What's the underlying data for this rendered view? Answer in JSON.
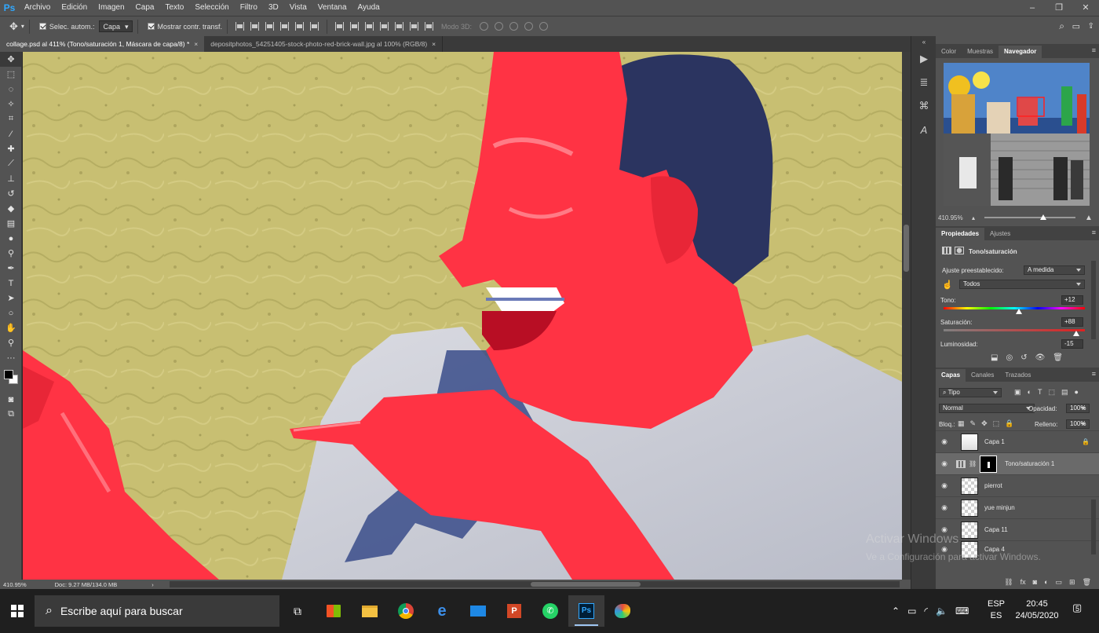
{
  "app": {
    "logo": "Ps"
  },
  "menu": [
    "Archivo",
    "Edición",
    "Imagen",
    "Capa",
    "Texto",
    "Selección",
    "Filtro",
    "3D",
    "Vista",
    "Ventana",
    "Ayuda"
  ],
  "options": {
    "auto_select_label": "Selec. autom.:",
    "auto_select_value": "Capa",
    "show_transform_label": "Mostrar contr. transf.",
    "mode3d_label": "Modo 3D:"
  },
  "tabs": [
    {
      "label": "collage.psd al 411% (Tono/saturación 1, Máscara de capa/8) *",
      "close": "×"
    },
    {
      "label": "depositphotos_54251405-stock-photo-red-brick-wall.jpg al 100% (RGB/8)",
      "close": "×"
    }
  ],
  "status": {
    "zoom": "410.95%",
    "doc": "Doc: 9.27 MB/134.0 MB"
  },
  "navigator": {
    "tabs": [
      "Color",
      "Muestras",
      "Navegador"
    ],
    "zoom": "410.95%"
  },
  "properties": {
    "tabs": [
      "Propiedades",
      "Ajustes"
    ],
    "title": "Tono/saturación",
    "preset_label": "Ajuste preestablecido:",
    "preset_value": "A medida",
    "channel_value": "Todos",
    "hue_label": "Tono:",
    "hue_value": "+12",
    "hue": 12,
    "sat_label": "Saturación:",
    "sat_value": "+88",
    "sat": 88,
    "light_label": "Luminosidad:",
    "light_value": "-15",
    "light": -15
  },
  "layers_panel": {
    "tabs": [
      "Capas",
      "Canales",
      "Trazados"
    ],
    "filter_value": "Tipo",
    "blend_value": "Normal",
    "opacity_label": "Opacidad:",
    "opacity_value": "100%",
    "lock_label": "Bloq.:",
    "fill_label": "Relleno:",
    "fill_value": "100%",
    "layers": [
      "Capa 1",
      "Tono/saturación 1",
      "pierrot",
      "yue minjun",
      "Capa 11",
      "Capa 4"
    ]
  },
  "watermark": {
    "line1": "Activar Windows",
    "line2": "Ve a Configuración para activar Windows."
  },
  "taskbar": {
    "search_placeholder": "Escribe aquí para buscar",
    "lang1": "ESP",
    "lang2": "ES",
    "time": "20:45",
    "date": "24/05/2020",
    "notif_count": "5"
  },
  "colors": {
    "accent": "#31a8ff",
    "skin": "#ff3b47",
    "wall": "#c4bb6e"
  }
}
